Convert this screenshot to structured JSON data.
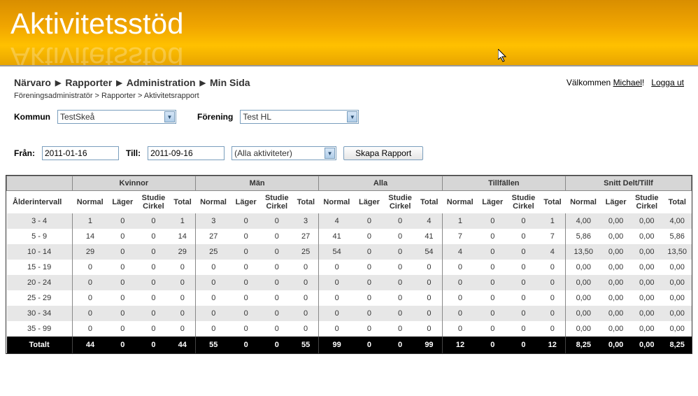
{
  "banner": {
    "title": "Aktivitetsstöd"
  },
  "nav": {
    "items": [
      "Närvaro",
      "Rapporter",
      "Administration",
      "Min Sida"
    ]
  },
  "welcome": {
    "prefix": "Välkommen ",
    "user": "Michael",
    "suffix": "!",
    "logout": "Logga ut"
  },
  "breadcrumb": "Föreningsadministratör > Rapporter > Aktivitetsrapport",
  "filters": {
    "kommun_label": "Kommun",
    "kommun_value": "TestSkeå",
    "forening_label": "Förening",
    "forening_value": "Test HL",
    "from_label": "Från:",
    "from_value": "2011-01-16",
    "till_label": "Till:",
    "till_value": "2011-09-16",
    "activity_value": "(Alla aktiviteter)",
    "button_label": "Skapa Rapport"
  },
  "table": {
    "group_headers": [
      "",
      "Kvinnor",
      "Män",
      "Alla",
      "Tillfällen",
      "Snitt Delt/Tillf"
    ],
    "sub_headers": [
      "Ålderintervall",
      "Normal",
      "Läger",
      "Studie Cirkel",
      "Total",
      "Normal",
      "Läger",
      "Studie Cirkel",
      "Total",
      "Normal",
      "Läger",
      "Studie Cirkel",
      "Total",
      "Normal",
      "Läger",
      "Studie Cirkel",
      "Total",
      "Normal",
      "Läger",
      "Studie Cirkel",
      "Total"
    ],
    "rows": [
      {
        "label": "3 - 4",
        "v": [
          "1",
          "0",
          "0",
          "1",
          "3",
          "0",
          "0",
          "3",
          "4",
          "0",
          "0",
          "4",
          "1",
          "0",
          "0",
          "1",
          "4,00",
          "0,00",
          "0,00",
          "4,00"
        ]
      },
      {
        "label": "5 - 9",
        "v": [
          "14",
          "0",
          "0",
          "14",
          "27",
          "0",
          "0",
          "27",
          "41",
          "0",
          "0",
          "41",
          "7",
          "0",
          "0",
          "7",
          "5,86",
          "0,00",
          "0,00",
          "5,86"
        ]
      },
      {
        "label": "10 - 14",
        "v": [
          "29",
          "0",
          "0",
          "29",
          "25",
          "0",
          "0",
          "25",
          "54",
          "0",
          "0",
          "54",
          "4",
          "0",
          "0",
          "4",
          "13,50",
          "0,00",
          "0,00",
          "13,50"
        ]
      },
      {
        "label": "15 - 19",
        "v": [
          "0",
          "0",
          "0",
          "0",
          "0",
          "0",
          "0",
          "0",
          "0",
          "0",
          "0",
          "0",
          "0",
          "0",
          "0",
          "0",
          "0,00",
          "0,00",
          "0,00",
          "0,00"
        ]
      },
      {
        "label": "20 - 24",
        "v": [
          "0",
          "0",
          "0",
          "0",
          "0",
          "0",
          "0",
          "0",
          "0",
          "0",
          "0",
          "0",
          "0",
          "0",
          "0",
          "0",
          "0,00",
          "0,00",
          "0,00",
          "0,00"
        ]
      },
      {
        "label": "25 - 29",
        "v": [
          "0",
          "0",
          "0",
          "0",
          "0",
          "0",
          "0",
          "0",
          "0",
          "0",
          "0",
          "0",
          "0",
          "0",
          "0",
          "0",
          "0,00",
          "0,00",
          "0,00",
          "0,00"
        ]
      },
      {
        "label": "30 - 34",
        "v": [
          "0",
          "0",
          "0",
          "0",
          "0",
          "0",
          "0",
          "0",
          "0",
          "0",
          "0",
          "0",
          "0",
          "0",
          "0",
          "0",
          "0,00",
          "0,00",
          "0,00",
          "0,00"
        ]
      },
      {
        "label": "35 - 99",
        "v": [
          "0",
          "0",
          "0",
          "0",
          "0",
          "0",
          "0",
          "0",
          "0",
          "0",
          "0",
          "0",
          "0",
          "0",
          "0",
          "0",
          "0,00",
          "0,00",
          "0,00",
          "0,00"
        ]
      }
    ],
    "footer": {
      "label": "Totalt",
      "v": [
        "44",
        "0",
        "0",
        "44",
        "55",
        "0",
        "0",
        "55",
        "99",
        "0",
        "0",
        "99",
        "12",
        "0",
        "0",
        "12",
        "8,25",
        "0,00",
        "0,00",
        "8,25"
      ]
    }
  }
}
